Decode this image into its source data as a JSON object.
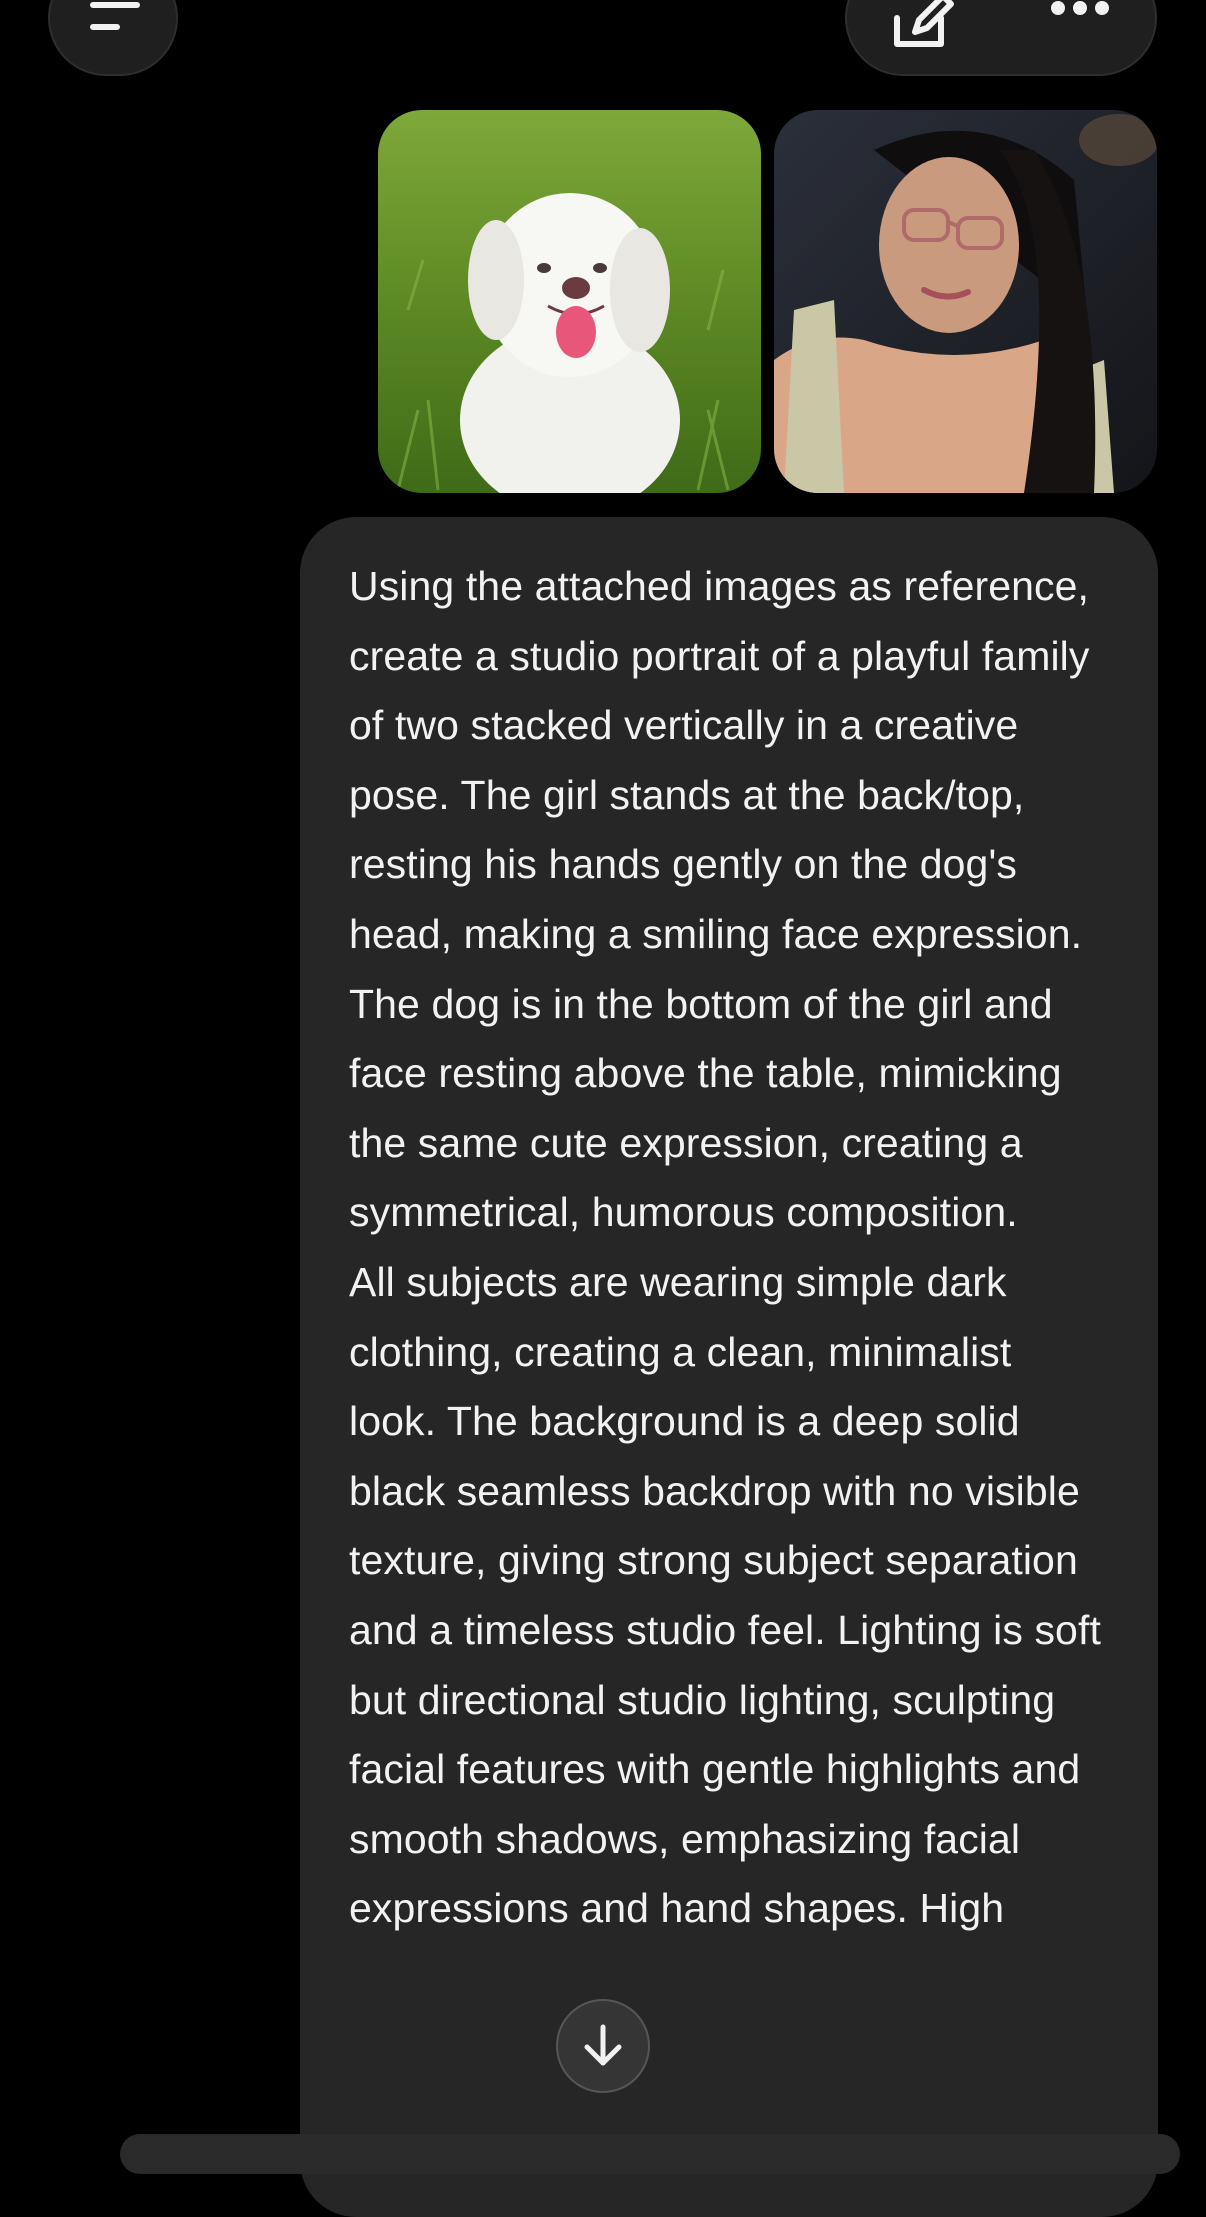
{
  "header": {
    "menu_icon": "menu-icon",
    "edit_icon": "edit-icon",
    "more_icon": "ellipsis-icon"
  },
  "attachments": [
    {
      "name": "dog-photo",
      "kind": "image"
    },
    {
      "name": "woman-photo",
      "kind": "image"
    }
  ],
  "message": {
    "paragraphs": [
      "Using the attached images as reference, create a studio portrait of a playful family of two stacked vertically in a creative pose. The girl stands at the back/top, resting his hands gently on the dog's head, making a smiling face expression. The dog is in the bottom of the girl and face resting above the table, mimicking the same cute expression, creating a symmetrical, humorous composition.",
      "All subjects are wearing simple dark clothing, creating a clean, minimalist look. The background is a deep solid black seamless backdrop with no visible texture, giving strong subject separation and a timeless studio feel. Lighting is soft but directional studio lighting, sculpting facial features with gentle highlights and smooth shadows, emphasizing facial expressions and hand shapes. High"
    ]
  },
  "scroll_button": {
    "icon": "arrow-down-icon"
  }
}
